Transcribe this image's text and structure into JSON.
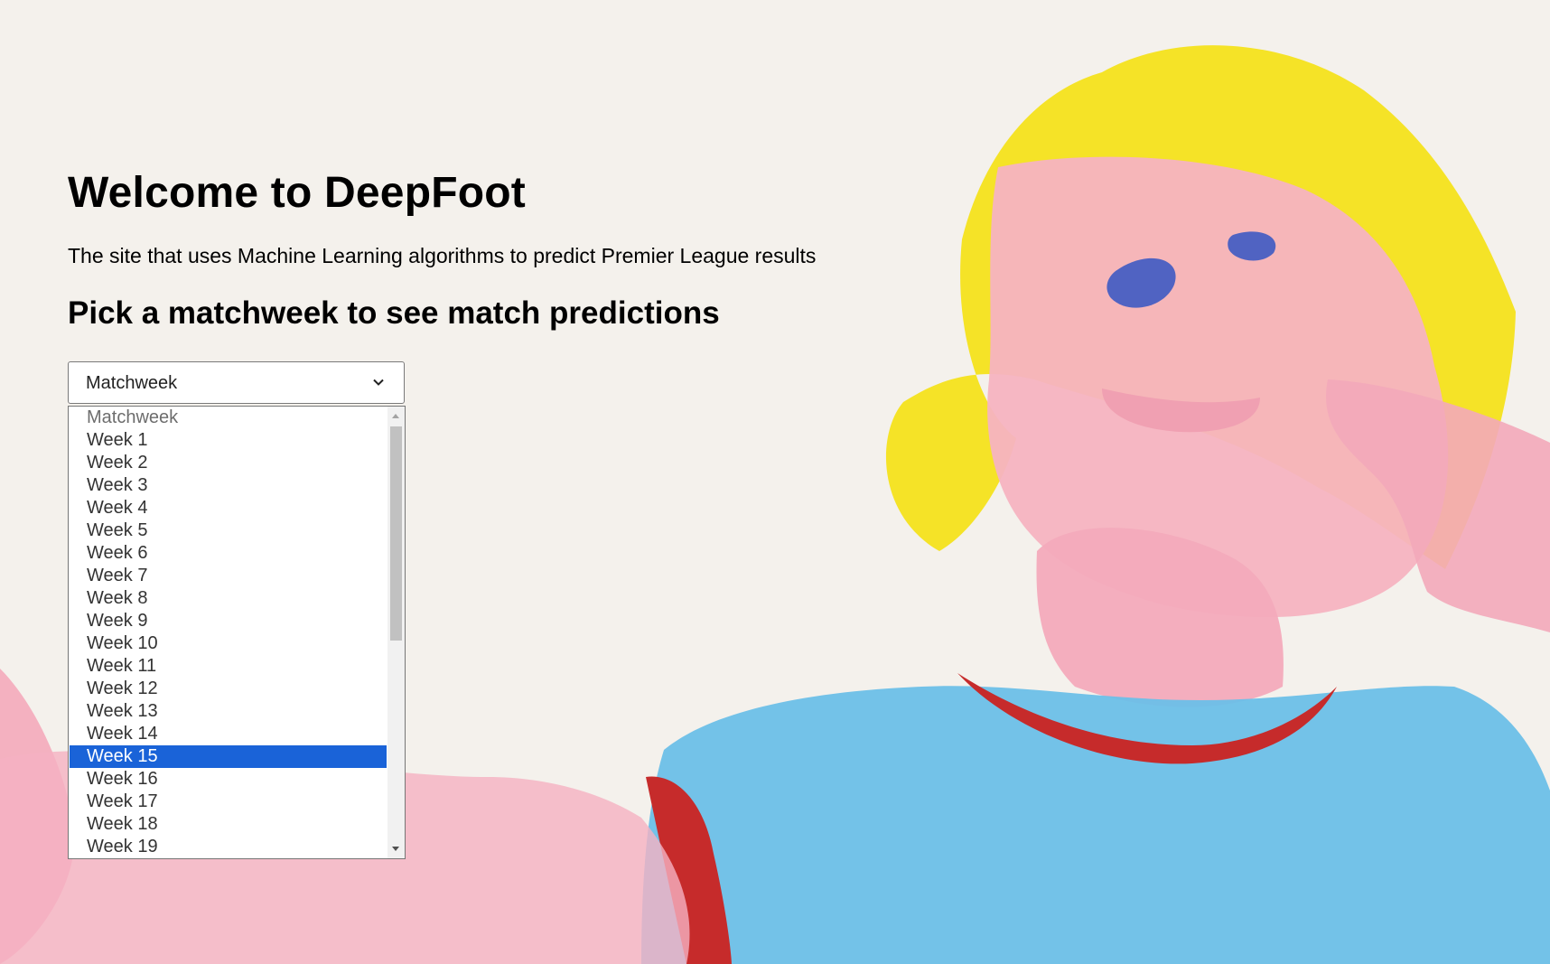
{
  "page": {
    "title": "Welcome to DeepFoot",
    "subtitle": "The site that uses Machine Learning algorithms to predict Premier League results",
    "heading": "Pick a matchweek to see match predictions"
  },
  "select": {
    "value": "Matchweek",
    "icon": "chevron-down-icon",
    "options": [
      "Matchweek",
      "Week 1",
      "Week 2",
      "Week 3",
      "Week 4",
      "Week 5",
      "Week 6",
      "Week 7",
      "Week 8",
      "Week 9",
      "Week 10",
      "Week 11",
      "Week 12",
      "Week 13",
      "Week 14",
      "Week 15",
      "Week 16",
      "Week 17",
      "Week 18",
      "Week 19"
    ],
    "highlighted_option": "Week 15"
  },
  "colors": {
    "highlight": "#1a63d8",
    "background": "#f4f1ec"
  }
}
